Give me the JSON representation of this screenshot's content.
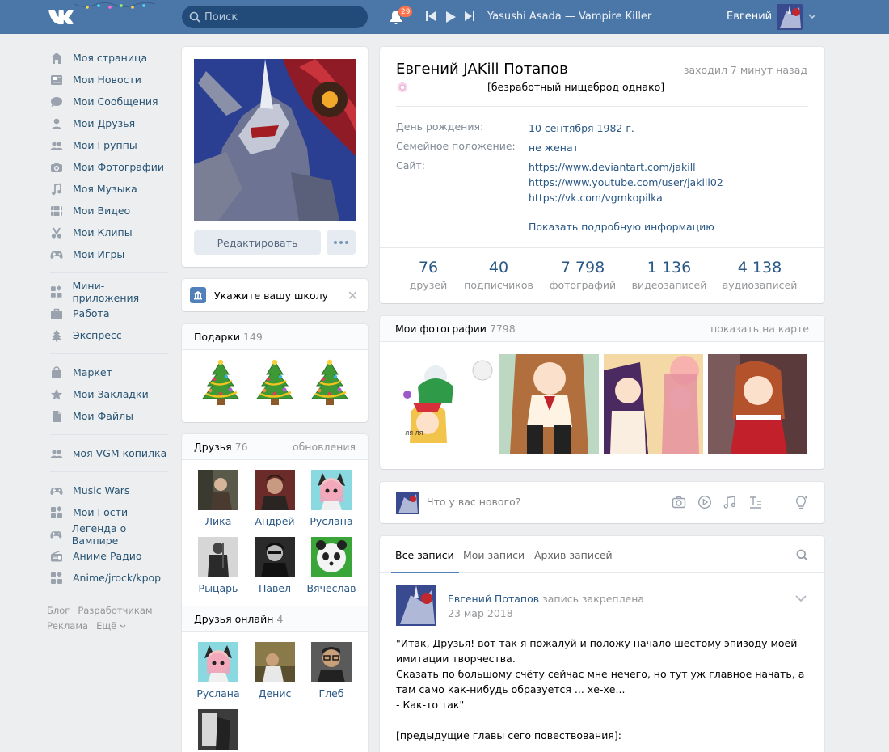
{
  "header": {
    "search_placeholder": "Поиск",
    "notifications_count": "29",
    "track": "Yasushi Asada — Vampire Killer",
    "user_name": "Евгений"
  },
  "nav": {
    "main": [
      {
        "label": "Моя страница",
        "icon": "home-icon"
      },
      {
        "label": "Мои Новости",
        "icon": "news-icon"
      },
      {
        "label": "Мои Сообщения",
        "icon": "messages-icon"
      },
      {
        "label": "Мои Друзья",
        "icon": "friends-icon"
      },
      {
        "label": "Мои Группы",
        "icon": "groups-icon"
      },
      {
        "label": "Мои Фотографии",
        "icon": "camera-icon"
      },
      {
        "label": "Моя Музыка",
        "icon": "music-icon"
      },
      {
        "label": "Мои Видео",
        "icon": "video-icon"
      },
      {
        "label": "Мои Клипы",
        "icon": "clips-icon"
      },
      {
        "label": "Мои Игры",
        "icon": "gamepad-icon"
      }
    ],
    "services": [
      {
        "label": "Мини-приложения",
        "icon": "apps-icon"
      },
      {
        "label": "Работа",
        "icon": "briefcase-icon"
      },
      {
        "label": "Экспресс",
        "icon": "tree-icon"
      }
    ],
    "extras": [
      {
        "label": "Маркет",
        "icon": "bag-icon"
      },
      {
        "label": "Мои Закладки",
        "icon": "star-icon"
      },
      {
        "label": "Мои Файлы",
        "icon": "file-icon"
      }
    ],
    "community": [
      {
        "label": "моя VGM копилка",
        "icon": "group-icon"
      }
    ],
    "apps": [
      {
        "label": "Music Wars",
        "icon": "gamepad-icon"
      },
      {
        "label": "Мои Гости",
        "icon": "apps-icon"
      },
      {
        "label": "Легенда о Вампире",
        "icon": "gamepad-icon"
      },
      {
        "label": "Аниме Радио",
        "icon": "radio-icon"
      },
      {
        "label": "Anime/jrock/kpop",
        "icon": "apps-icon"
      }
    ],
    "footer": {
      "blog": "Блог",
      "developers": "Разработчикам",
      "ads": "Реклама",
      "more": "Ещё"
    }
  },
  "profile": {
    "edit_button": "Редактировать",
    "school_prompt": "Укажите вашу школу",
    "name": "Евгений JAKill Потапов",
    "last_seen": "заходил 7 минут назад",
    "status": "[безработный нищеброд однако]",
    "birthday_label": "День рождения:",
    "birthday_value": "10 сентября 1982 г.",
    "family_label": "Семейное положение:",
    "family_value": "не женат",
    "site_label": "Сайт:",
    "sites": [
      "https://www.deviantart.com/jakill",
      "https://www.youtube.com/user/jakill02",
      "https://vk.com/vgmkopilka"
    ],
    "show_more": "Показать подробную информацию",
    "counters": [
      {
        "num": "76",
        "cap": "друзей"
      },
      {
        "num": "40",
        "cap": "подписчиков"
      },
      {
        "num": "7 798",
        "cap": "фотографий"
      },
      {
        "num": "1 136",
        "cap": "видеозаписей"
      },
      {
        "num": "4 138",
        "cap": "аудиозаписей"
      }
    ]
  },
  "gifts": {
    "title": "Подарки",
    "count": "149"
  },
  "friends": {
    "title": "Друзья",
    "count": "76",
    "updates": "обновления",
    "list": [
      "Лика",
      "Андрей",
      "Руслана",
      "Рыцарь",
      "Павел",
      "Вячеслав"
    ],
    "online_title": "Друзья онлайн",
    "online_count": "4",
    "online": [
      "Руслана",
      "Денис",
      "Глеб"
    ]
  },
  "photos": {
    "title": "Мои фотографии",
    "count": "7798",
    "map_link": "показать на карте"
  },
  "postbox": {
    "placeholder": "Что у вас нового?"
  },
  "wall": {
    "tabs": [
      "Все записи",
      "Мои записи",
      "Архив записей"
    ],
    "post": {
      "author": "Евгений Потапов",
      "pinned": "запись закреплена",
      "date": "23 мар 2018",
      "lines": [
        "\"Итак, Друзья! вот так я пожалуй и положу начало шестому эпизоду моей имитации творчества.",
        "Сказать по большому счёту сейчас мне нечего, но тут уж главное начать, а там само как-нибудь образуется ... хе-хе...",
        "- Как-то так\"",
        "",
        "[предыдущие главы сего повествования]:"
      ]
    }
  },
  "colors": {
    "header": "#4a76a8",
    "link": "#2a5885",
    "background": "#edeef0",
    "badge": "#ff734c"
  }
}
